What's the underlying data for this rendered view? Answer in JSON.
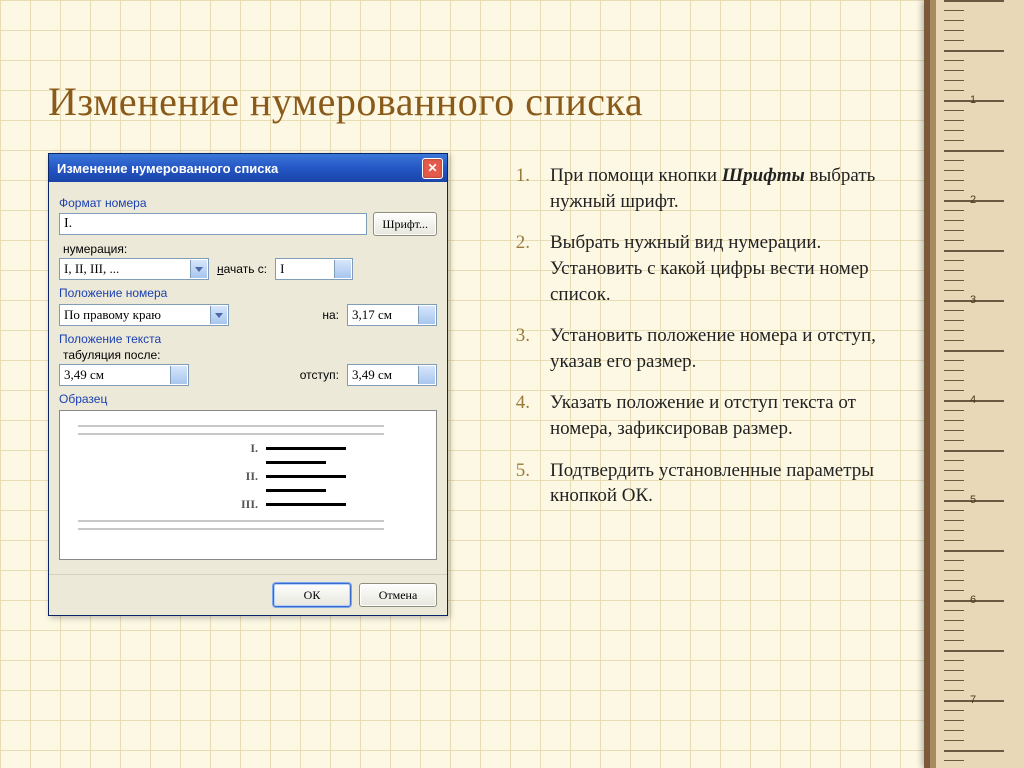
{
  "slide": {
    "title": "Изменение нумерованного списка"
  },
  "dialog": {
    "title": "Изменение нумерованного списка",
    "section_format": "Формат номера",
    "format_value": "I.",
    "font_btn": "Шрифт...",
    "numbering_label": "нумерация:",
    "numbering_value": "I, II, III, ...",
    "start_label_pre": "н",
    "start_label": "ачать с:",
    "start_value": "I",
    "section_number_pos": "Положение номера",
    "align_value": "По правому краю",
    "at_label": "на:",
    "at_value": "3,17 см",
    "section_text_pos": "Положение текста",
    "tab_label": "табуляция после:",
    "tab_value": "3,49 см",
    "indent_label": "отступ:",
    "indent_value": "3,49 см",
    "section_preview": "Образец",
    "preview_nums": [
      "I.",
      "II.",
      "III."
    ],
    "ok": "ОК",
    "cancel": "Отмена"
  },
  "steps": [
    {
      "n": "1.",
      "pre": "При помощи кнопки ",
      "em": "Шрифты",
      "post": " выбрать нужный шрифт."
    },
    {
      "n": "2.",
      "pre": "Выбрать нужный вид нумерации. Установить с какой цифры вести номер список.",
      "em": "",
      "post": ""
    },
    {
      "n": "3.",
      "pre": "Установить положение номера и отступ, указав его размер.",
      "em": "",
      "post": ""
    },
    {
      "n": "4.",
      "pre": "Указать положение и отступ текста от номера, зафиксировав размер.",
      "em": "",
      "post": ""
    },
    {
      "n": "5.",
      "pre": "Подтвердить установленные параметры кнопкой ОК.",
      "em": "",
      "post": ""
    }
  ]
}
